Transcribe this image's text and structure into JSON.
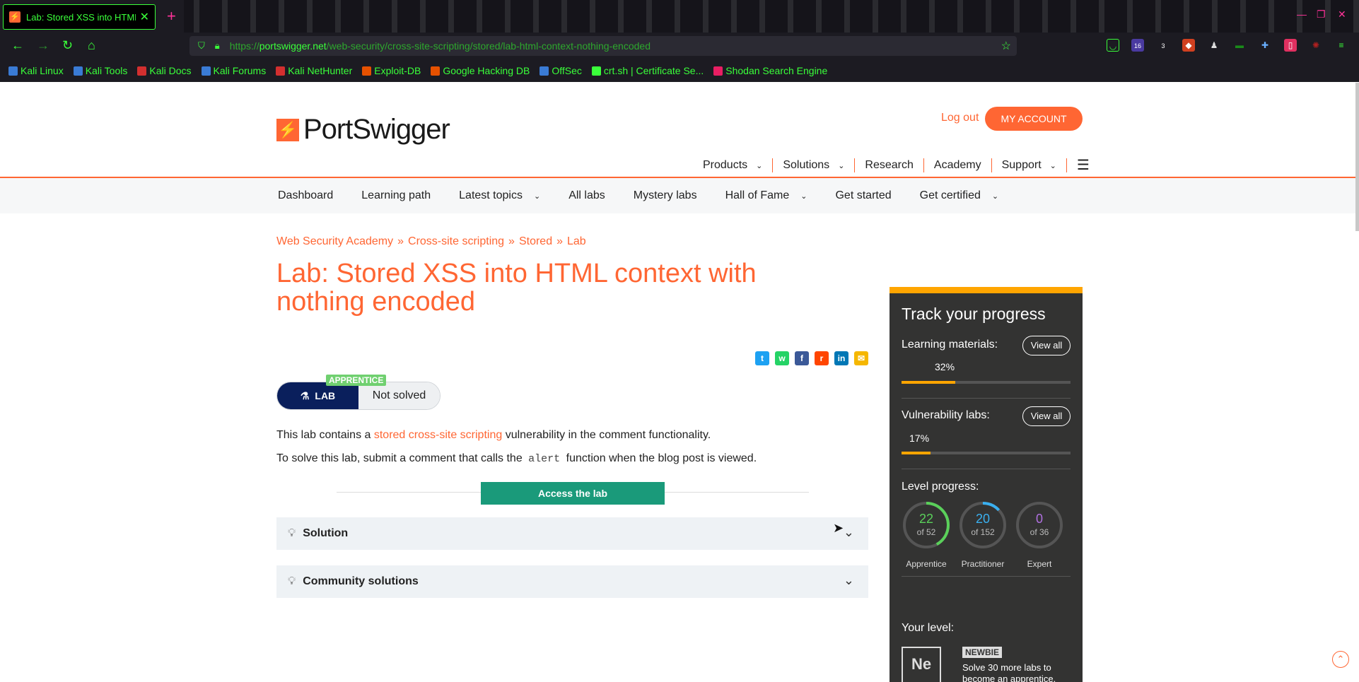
{
  "browser": {
    "tab_title": "Lab: Stored XSS into HTML",
    "url_host": "portswigger.net",
    "url_prefix": "https://",
    "url_path": "/web-security/cross-site-scripting/stored/lab-html-context-nothing-encoded",
    "ext_badges": [
      "16",
      "3"
    ],
    "bookmarks": [
      {
        "label": "Kali Linux",
        "color": "#3a7bd5"
      },
      {
        "label": "Kali Tools",
        "color": "#3a7bd5"
      },
      {
        "label": "Kali Docs",
        "color": "#d32f2f"
      },
      {
        "label": "Kali Forums",
        "color": "#3a7bd5"
      },
      {
        "label": "Kali NetHunter",
        "color": "#d32f2f"
      },
      {
        "label": "Exploit-DB",
        "color": "#e65100"
      },
      {
        "label": "Google Hacking DB",
        "color": "#e65100"
      },
      {
        "label": "OffSec",
        "color": "#3a7bd5"
      },
      {
        "label": "crt.sh | Certificate Se...",
        "color": "#3aff3a"
      },
      {
        "label": "Shodan Search Engine",
        "color": "#e91e63"
      }
    ]
  },
  "header": {
    "logo_text": "PortSwigger",
    "logout": "Log out",
    "my_account": "MY ACCOUNT",
    "nav": [
      "Products",
      "Solutions",
      "Research",
      "Academy",
      "Support"
    ]
  },
  "subnav": [
    {
      "label": "Dashboard",
      "dropdown": false
    },
    {
      "label": "Learning path",
      "dropdown": false
    },
    {
      "label": "Latest topics",
      "dropdown": true
    },
    {
      "label": "All labs",
      "dropdown": false
    },
    {
      "label": "Mystery labs",
      "dropdown": false
    },
    {
      "label": "Hall of Fame",
      "dropdown": true
    },
    {
      "label": "Get started",
      "dropdown": false
    },
    {
      "label": "Get certified",
      "dropdown": true
    }
  ],
  "breadcrumbs": [
    "Web Security Academy",
    "Cross-site scripting",
    "Stored",
    "Lab"
  ],
  "lab": {
    "title": "Lab: Stored XSS into HTML context with nothing encoded",
    "level_badge": "APPRENTICE",
    "lab_label": "LAB",
    "status": "Not solved",
    "desc1_before": "This lab contains a ",
    "desc1_link": "stored cross-site scripting",
    "desc1_after": " vulnerability in the comment functionality.",
    "desc2_before": "To solve this lab, submit a comment that calls the",
    "desc2_code": "alert",
    "desc2_after": "function when the blog post is viewed.",
    "access_button": "Access the lab",
    "accordions": [
      "Solution",
      "Community solutions"
    ]
  },
  "progress": {
    "title": "Track your progress",
    "learning_label": "Learning materials:",
    "learning_pct": "32%",
    "learning_value": 32,
    "vuln_label": "Vulnerability labs:",
    "vuln_pct": "17%",
    "vuln_value": 17,
    "view_all": "View all",
    "level_label": "Level progress:",
    "levels": [
      {
        "name": "Apprentice",
        "num": "22",
        "of": "of 52",
        "color": "#5ad05a",
        "fraction": 0.42
      },
      {
        "name": "Practitioner",
        "num": "20",
        "of": "of 152",
        "color": "#3ab0f0",
        "fraction": 0.13
      },
      {
        "name": "Expert",
        "num": "0",
        "of": "of 36",
        "color": "#b070e0",
        "fraction": 0
      }
    ],
    "your_level": "Your level:",
    "level_symbol": "Ne",
    "level_name": "NEWBIE",
    "level_desc": "Solve 30 more labs to become an apprentice."
  },
  "colors": {
    "accent": "#ff6633",
    "progress": "#ffa500",
    "access_btn": "#1a9a7a",
    "lab_pill": "#0a1f5c"
  }
}
